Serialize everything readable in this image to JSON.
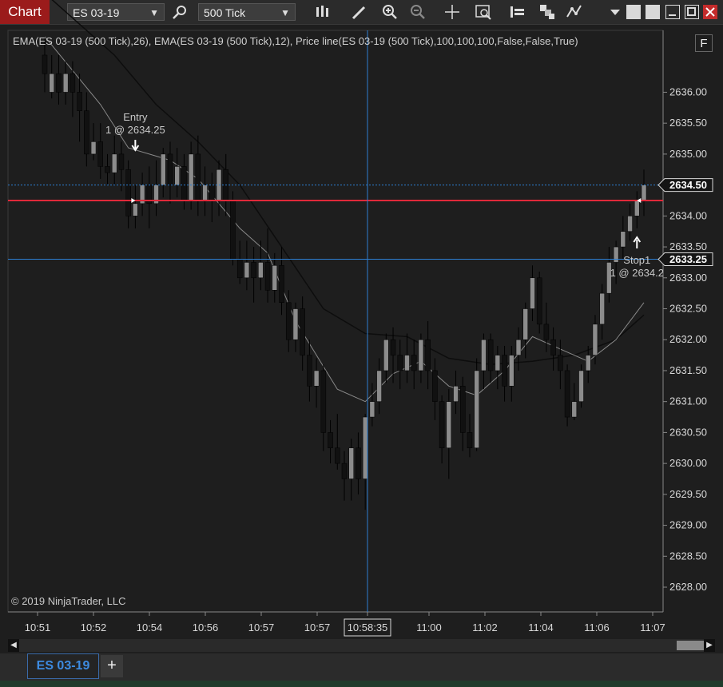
{
  "toolbar": {
    "chart_tab": "Chart",
    "instrument": "ES 03-19",
    "interval": "500 Tick",
    "icons": [
      "search-icon",
      "bar-type-icon",
      "draw-icon",
      "zoom-in-icon",
      "zoom-out-icon",
      "crosshair-icon",
      "data-box-icon",
      "order-ladder-icon",
      "strategy-icon",
      "indicator-icon"
    ]
  },
  "indicator_label": "EMA(ES 03-19 (500 Tick),26), EMA(ES 03-19 (500 Tick),12), Price line(ES 03-19 (500 Tick),100,100,100,False,False,True)",
  "copyright": "© 2019 NinjaTrader, LLC",
  "f_button": "F",
  "bottom": {
    "tab": "ES 03-19",
    "add": "+"
  },
  "colors": {
    "up": "#8c8c8c",
    "down": "#111111",
    "price_line": "#e0293a",
    "cursor": "#2d7fd3",
    "ema26": "#0d0d0d",
    "ema12": "#8a8a8a"
  },
  "chart_data": {
    "type": "candlestick",
    "ylim": [
      2627.6,
      2637.0
    ],
    "y_ticks": [
      "2636.00",
      "2635.50",
      "2635.00",
      "2634.50",
      "2634.00",
      "2633.50",
      "2633.00",
      "2632.50",
      "2632.00",
      "2631.50",
      "2631.00",
      "2630.50",
      "2630.00",
      "2629.50",
      "2629.00",
      "2628.50",
      "2628.00"
    ],
    "x_ticks": [
      "10:51",
      "10:52",
      "10:54",
      "10:56",
      "10:57",
      "10:57",
      "10:58:35",
      "11:00",
      "11:02",
      "11:04",
      "11:06",
      "11:07"
    ],
    "candles": [
      [
        2636.6,
        2636.3,
        2636.9,
        2636.0
      ],
      [
        2636.0,
        2636.3,
        2636.6,
        2635.9
      ],
      [
        2636.3,
        2636.0,
        2636.6,
        2635.8
      ],
      [
        2636.0,
        2636.3,
        2636.5,
        2635.8
      ],
      [
        2636.3,
        2636.0,
        2636.5,
        2635.6
      ],
      [
        2636.0,
        2635.7,
        2636.3,
        2635.2
      ],
      [
        2635.7,
        2635.0,
        2636.0,
        2634.8
      ],
      [
        2635.0,
        2635.2,
        2635.5,
        2634.9
      ],
      [
        2635.2,
        2634.8,
        2635.5,
        2634.6
      ],
      [
        2634.8,
        2634.7,
        2635.0,
        2634.5
      ],
      [
        2634.7,
        2635.0,
        2635.3,
        2634.5
      ],
      [
        2635.0,
        2634.75,
        2635.2,
        2634.4
      ],
      [
        2634.75,
        2634.0,
        2634.9,
        2633.8
      ],
      [
        2634.0,
        2634.2,
        2634.5,
        2633.8
      ],
      [
        2634.2,
        2634.5,
        2634.7,
        2634.0
      ],
      [
        2634.5,
        2634.2,
        2634.8,
        2633.8
      ],
      [
        2634.2,
        2634.5,
        2634.9,
        2634.0
      ],
      [
        2634.5,
        2635.0,
        2635.1,
        2634.3
      ],
      [
        2635.0,
        2634.5,
        2635.2,
        2634.2
      ],
      [
        2634.5,
        2634.8,
        2635.1,
        2634.3
      ],
      [
        2634.8,
        2634.25,
        2635.0,
        2634.1
      ],
      [
        2634.25,
        2635.0,
        2635.2,
        2634.1
      ],
      [
        2635.0,
        2634.25,
        2635.3,
        2634.0
      ],
      [
        2634.25,
        2634.5,
        2634.8,
        2634.0
      ],
      [
        2634.5,
        2634.25,
        2634.7,
        2633.9
      ],
      [
        2634.25,
        2634.75,
        2634.9,
        2634.0
      ],
      [
        2634.75,
        2634.25,
        2635.0,
        2634.0
      ],
      [
        2634.25,
        2633.3,
        2634.4,
        2633.2
      ],
      [
        2633.3,
        2633.0,
        2633.6,
        2632.9
      ],
      [
        2633.0,
        2633.25,
        2633.6,
        2632.8
      ],
      [
        2633.25,
        2633.0,
        2633.5,
        2632.6
      ],
      [
        2633.0,
        2633.25,
        2633.6,
        2632.8
      ],
      [
        2633.25,
        2632.8,
        2633.8,
        2632.6
      ],
      [
        2632.8,
        2633.2,
        2633.4,
        2632.6
      ],
      [
        2633.2,
        2632.6,
        2633.5,
        2632.4
      ],
      [
        2632.6,
        2632.0,
        2632.8,
        2631.8
      ],
      [
        2632.0,
        2632.5,
        2632.6,
        2631.8
      ],
      [
        2632.5,
        2631.75,
        2632.7,
        2631.5
      ],
      [
        2631.75,
        2631.25,
        2632.0,
        2631.0
      ],
      [
        2631.25,
        2631.5,
        2631.7,
        2630.9
      ],
      [
        2631.5,
        2630.5,
        2631.6,
        2630.2
      ],
      [
        2630.5,
        2630.25,
        2630.7,
        2630.0
      ],
      [
        2630.25,
        2630.0,
        2630.8,
        2629.9
      ],
      [
        2630.0,
        2629.75,
        2630.2,
        2629.4
      ],
      [
        2629.75,
        2630.25,
        2630.4,
        2629.4
      ],
      [
        2630.25,
        2629.75,
        2630.5,
        2629.5
      ],
      [
        2629.75,
        2630.75,
        2630.8,
        2629.25
      ],
      [
        2630.75,
        2631.0,
        2631.3,
        2630.6
      ],
      [
        2631.0,
        2631.5,
        2631.7,
        2630.8
      ],
      [
        2631.5,
        2632.0,
        2632.1,
        2631.3
      ],
      [
        2632.0,
        2631.75,
        2632.2,
        2631.3
      ],
      [
        2631.75,
        2631.5,
        2632.0,
        2631.2
      ],
      [
        2631.5,
        2631.75,
        2632.1,
        2631.3
      ],
      [
        2631.75,
        2631.5,
        2632.0,
        2631.2
      ],
      [
        2631.5,
        2632.0,
        2632.1,
        2631.3
      ],
      [
        2632.0,
        2631.5,
        2632.3,
        2631.2
      ],
      [
        2631.5,
        2631.0,
        2631.7,
        2630.7
      ],
      [
        2631.0,
        2630.25,
        2631.1,
        2630.0
      ],
      [
        2630.25,
        2631.0,
        2631.2,
        2629.75
      ],
      [
        2631.0,
        2631.25,
        2631.5,
        2630.8
      ],
      [
        2631.25,
        2630.5,
        2631.4,
        2630.2
      ],
      [
        2630.5,
        2630.25,
        2630.8,
        2630.1
      ],
      [
        2630.25,
        2631.5,
        2631.7,
        2630.2
      ],
      [
        2631.5,
        2632.0,
        2632.1,
        2631.2
      ],
      [
        2632.0,
        2631.5,
        2632.1,
        2631.3
      ],
      [
        2631.5,
        2631.75,
        2631.9,
        2631.2
      ],
      [
        2631.75,
        2631.25,
        2631.9,
        2631.0
      ],
      [
        2631.25,
        2631.75,
        2631.9,
        2631.0
      ],
      [
        2631.75,
        2632.0,
        2632.2,
        2631.5
      ],
      [
        2632.0,
        2632.5,
        2632.6,
        2631.7
      ],
      [
        2632.5,
        2633.0,
        2633.2,
        2632.3
      ],
      [
        2633.0,
        2632.25,
        2633.1,
        2632.1
      ],
      [
        2632.25,
        2632.0,
        2632.6,
        2631.8
      ],
      [
        2632.0,
        2631.75,
        2632.2,
        2631.5
      ],
      [
        2631.75,
        2631.5,
        2632.0,
        2631.2
      ],
      [
        2631.5,
        2630.75,
        2631.6,
        2630.6
      ],
      [
        2630.75,
        2631.0,
        2631.3,
        2630.7
      ],
      [
        2631.0,
        2631.5,
        2631.6,
        2630.9
      ],
      [
        2631.5,
        2631.75,
        2631.9,
        2631.3
      ],
      [
        2631.75,
        2632.25,
        2632.4,
        2631.6
      ],
      [
        2632.25,
        2632.75,
        2632.9,
        2632.0
      ],
      [
        2632.75,
        2633.25,
        2633.5,
        2632.6
      ],
      [
        2633.25,
        2633.5,
        2633.6,
        2632.9
      ],
      [
        2633.5,
        2633.75,
        2634.0,
        2633.3
      ],
      [
        2633.75,
        2634.0,
        2634.2,
        2633.6
      ],
      [
        2634.0,
        2634.25,
        2634.4,
        2633.8
      ],
      [
        2634.25,
        2634.5,
        2634.75,
        2634.0
      ]
    ],
    "ema12": [
      [
        0,
        2636.9
      ],
      [
        8,
        2635.8
      ],
      [
        12,
        2635.1
      ],
      [
        18,
        2634.9
      ],
      [
        22,
        2634.6
      ],
      [
        28,
        2633.8
      ],
      [
        32,
        2633.4
      ],
      [
        36,
        2632.3
      ],
      [
        42,
        2631.2
      ],
      [
        46,
        2631.0
      ],
      [
        50,
        2631.45
      ],
      [
        54,
        2631.65
      ],
      [
        58,
        2631.25
      ],
      [
        62,
        2631.1
      ],
      [
        66,
        2631.5
      ],
      [
        70,
        2632.05
      ],
      [
        74,
        2631.85
      ],
      [
        78,
        2631.65
      ],
      [
        82,
        2632.0
      ],
      [
        86,
        2632.6
      ]
    ],
    "ema26": [
      [
        0,
        2637.6
      ],
      [
        10,
        2636.6
      ],
      [
        16,
        2635.8
      ],
      [
        22,
        2635.2
      ],
      [
        28,
        2634.5
      ],
      [
        34,
        2633.5
      ],
      [
        40,
        2632.5
      ],
      [
        46,
        2632.1
      ],
      [
        52,
        2632.05
      ],
      [
        58,
        2631.7
      ],
      [
        64,
        2631.6
      ],
      [
        70,
        2631.65
      ],
      [
        76,
        2631.75
      ],
      [
        82,
        2632.0
      ],
      [
        86,
        2632.4
      ]
    ],
    "price_line": {
      "value": 2634.25
    },
    "bid_line": {
      "value": 2634.5,
      "label": "2634.50"
    },
    "cursor_line": {
      "value": 2633.3,
      "label": "2633.25"
    },
    "crosshair_time": "10:58:35",
    "annotations": {
      "entry": {
        "title": "Entry",
        "detail": "1 @ 2634.25",
        "bar": 13
      },
      "stop": {
        "title": "Stop1",
        "detail": "1 @ 2634.2",
        "bar": 85
      }
    }
  }
}
